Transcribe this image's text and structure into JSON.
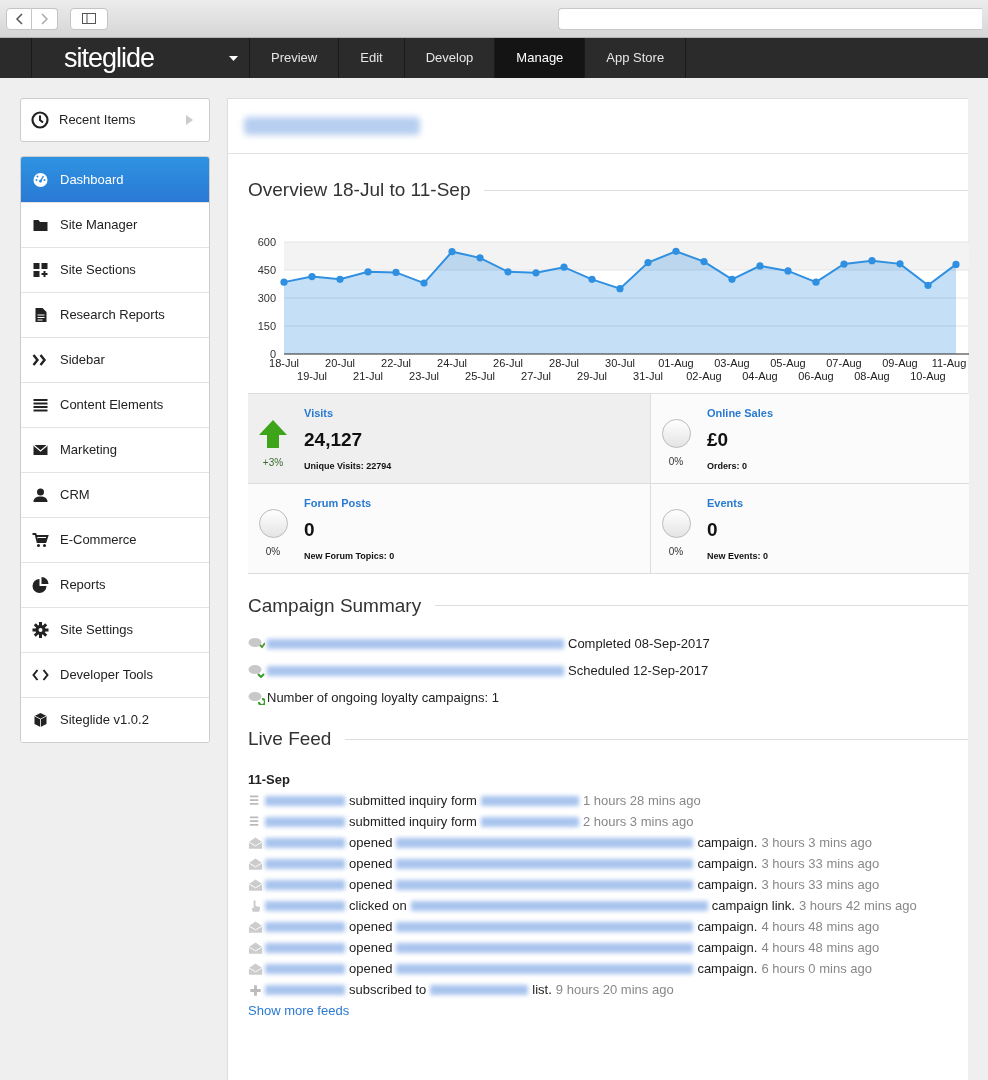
{
  "nav": {
    "logo": "siteglide",
    "tabs": [
      {
        "label": "Preview",
        "selected": false
      },
      {
        "label": "Edit",
        "selected": false
      },
      {
        "label": "Develop",
        "selected": false
      },
      {
        "label": "Manage",
        "selected": true
      },
      {
        "label": "App Store",
        "selected": false
      }
    ]
  },
  "sidebar": {
    "recent": "Recent Items",
    "items": [
      {
        "label": "Dashboard",
        "selected": true
      },
      {
        "label": "Site Manager",
        "selected": false
      },
      {
        "label": "Site Sections",
        "selected": false
      },
      {
        "label": "Research Reports",
        "selected": false
      },
      {
        "label": "Sidebar",
        "selected": false
      },
      {
        "label": "Content Elements",
        "selected": false
      },
      {
        "label": "Marketing",
        "selected": false
      },
      {
        "label": "CRM",
        "selected": false
      },
      {
        "label": "E-Commerce",
        "selected": false
      },
      {
        "label": "Reports",
        "selected": false
      },
      {
        "label": "Site Settings",
        "selected": false
      },
      {
        "label": "Developer Tools",
        "selected": false
      },
      {
        "label": "Siteglide v1.0.2",
        "selected": false
      }
    ]
  },
  "overview": {
    "title": "Overview 18-Jul to 11-Sep",
    "chart_data": {
      "type": "area",
      "categories": [
        "18-Jul",
        "19-Jul",
        "20-Jul",
        "21-Jul",
        "22-Jul",
        "23-Jul",
        "24-Jul",
        "25-Jul",
        "26-Jul",
        "27-Jul",
        "28-Jul",
        "29-Jul",
        "30-Jul",
        "31-Jul",
        "01-Aug",
        "02-Aug",
        "03-Aug",
        "04-Aug",
        "05-Aug",
        "06-Aug",
        "07-Aug",
        "08-Aug",
        "09-Aug",
        "10-Aug",
        "11-Aug"
      ],
      "series": [
        {
          "color": "#2f8fe0",
          "values": [
            385,
            415,
            400,
            440,
            437,
            380,
            548,
            515,
            440,
            435,
            465,
            400,
            350,
            490,
            550,
            495,
            400,
            472,
            445,
            385,
            482,
            500,
            483,
            368,
            480
          ]
        }
      ],
      "grid": true,
      "ylim": [
        0,
        600
      ],
      "yticks": [
        0,
        150,
        300,
        450,
        600
      ]
    }
  },
  "stats": [
    {
      "kind": "up",
      "label": "Visits",
      "value": "24,127",
      "change": "+3%",
      "sub": "Unique Visits: 22794"
    },
    {
      "kind": "flat",
      "label": "Online Sales",
      "value": "£0",
      "change": "0%",
      "sub": "Orders: 0"
    },
    {
      "kind": "flat",
      "label": "Forum Posts",
      "value": "0",
      "change": "0%",
      "sub": "New Forum Topics: 0"
    },
    {
      "kind": "flat",
      "label": "Events",
      "value": "0",
      "change": "0%",
      "sub": "New Events: 0"
    }
  ],
  "campaigns": {
    "title": "Campaign Summary",
    "items": [
      {
        "kind": "completed",
        "segments": [
          {
            "kind": "redacted_campaign"
          },
          {
            "kind": "text",
            "text": "Completed 08-Sep-2017"
          }
        ]
      },
      {
        "kind": "scheduled",
        "segments": [
          {
            "kind": "redacted_campaign"
          },
          {
            "kind": "text",
            "text": "Scheduled 12-Sep-2017"
          }
        ]
      },
      {
        "kind": "loyalty",
        "segments": [
          {
            "kind": "text",
            "text": "Number of ongoing loyalty campaigns: 1"
          }
        ]
      }
    ]
  },
  "feed": {
    "title": "Live Feed",
    "date": "11-Sep",
    "items": [
      {
        "kind": "form",
        "segments": [
          {
            "kind": "redacted_name"
          },
          {
            "kind": "text",
            "text": "submitted inquiry form"
          },
          {
            "kind": "redacted_form"
          },
          {
            "kind": "time",
            "text": "1 hours 28 mins ago"
          }
        ]
      },
      {
        "kind": "form",
        "segments": [
          {
            "kind": "redacted_name"
          },
          {
            "kind": "text",
            "text": "submitted inquiry form"
          },
          {
            "kind": "redacted_form"
          },
          {
            "kind": "time",
            "text": "2 hours 3 mins ago"
          }
        ]
      },
      {
        "kind": "open",
        "segments": [
          {
            "kind": "redacted_name"
          },
          {
            "kind": "text",
            "text": "opened"
          },
          {
            "kind": "redacted_campaign"
          },
          {
            "kind": "text",
            "text": "campaign."
          },
          {
            "kind": "time",
            "text": "3 hours 3 mins ago"
          }
        ]
      },
      {
        "kind": "open",
        "segments": [
          {
            "kind": "redacted_name"
          },
          {
            "kind": "text",
            "text": "opened"
          },
          {
            "kind": "redacted_campaign"
          },
          {
            "kind": "text",
            "text": "campaign."
          },
          {
            "kind": "time",
            "text": "3 hours 33 mins ago"
          }
        ]
      },
      {
        "kind": "open",
        "segments": [
          {
            "kind": "redacted_name"
          },
          {
            "kind": "text",
            "text": "opened"
          },
          {
            "kind": "redacted_campaign"
          },
          {
            "kind": "text",
            "text": "campaign."
          },
          {
            "kind": "time",
            "text": "3 hours 33 mins ago"
          }
        ]
      },
      {
        "kind": "click",
        "segments": [
          {
            "kind": "redacted_name"
          },
          {
            "kind": "text",
            "text": "clicked on"
          },
          {
            "kind": "redacted_campaign"
          },
          {
            "kind": "text",
            "text": "campaign link."
          },
          {
            "kind": "time",
            "text": "3 hours 42 mins ago"
          }
        ]
      },
      {
        "kind": "open",
        "segments": [
          {
            "kind": "redacted_name"
          },
          {
            "kind": "text",
            "text": "opened"
          },
          {
            "kind": "redacted_campaign"
          },
          {
            "kind": "text",
            "text": "campaign."
          },
          {
            "kind": "time",
            "text": "4 hours 48 mins ago"
          }
        ]
      },
      {
        "kind": "open",
        "segments": [
          {
            "kind": "redacted_name"
          },
          {
            "kind": "text",
            "text": "opened"
          },
          {
            "kind": "redacted_campaign"
          },
          {
            "kind": "text",
            "text": "campaign."
          },
          {
            "kind": "time",
            "text": "4 hours 48 mins ago"
          }
        ]
      },
      {
        "kind": "open",
        "segments": [
          {
            "kind": "redacted_name"
          },
          {
            "kind": "text",
            "text": "opened"
          },
          {
            "kind": "redacted_campaign"
          },
          {
            "kind": "text",
            "text": "campaign."
          },
          {
            "kind": "time",
            "text": "6 hours 0 mins ago"
          }
        ]
      },
      {
        "kind": "subscribe",
        "segments": [
          {
            "kind": "redacted_name"
          },
          {
            "kind": "text",
            "text": "subscribed to"
          },
          {
            "kind": "redacted_form"
          },
          {
            "kind": "text",
            "text": "list."
          },
          {
            "kind": "time",
            "text": "9 hours 20 mins ago"
          }
        ]
      }
    ],
    "more": "Show more feeds"
  }
}
